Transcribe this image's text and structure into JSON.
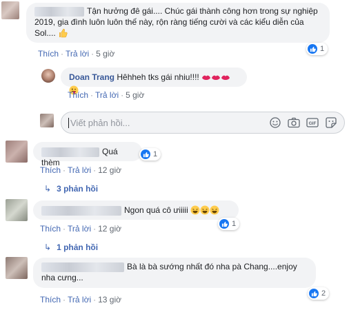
{
  "comments": [
    {
      "text": "Tận hưởng đê gái.... Chúc gái thành công hơn trong sự nghiệp 2019, gia đình luôn luôn thế này, rộn ràng tiếng cười và các kiểu diễn của Sol.... ",
      "like_label": "Thích",
      "reply_label": "Trả lời",
      "time": "5 giờ",
      "reaction_count": "1"
    },
    {
      "author": "Doan Trang",
      "text": "Hêhheh tks gái nhiu!!!! ",
      "like_label": "Thích",
      "reply_label": "Trả lời",
      "time": "5 giờ"
    },
    {
      "text": "Quá thèm",
      "like_label": "Thích",
      "reply_label": "Trả lời",
      "time": "12 giờ",
      "reaction_count": "1",
      "replies_label": "3 phản hồi"
    },
    {
      "text": "Ngon quá cô ưiiiii ",
      "like_label": "Thích",
      "reply_label": "Trả lời",
      "time": "12 giờ",
      "reaction_count": "1",
      "replies_label": "1 phản hồi"
    },
    {
      "text": "Bà là bà sướng nhất đó nha pà Chang....enjoy nha cưng...",
      "like_label": "Thích",
      "reply_label": "Trả lời",
      "time": "13 giờ",
      "reaction_count": "2"
    }
  ],
  "reply_input": {
    "placeholder": "Viết phản hồi..."
  },
  "icons": [
    "like-icon",
    "thumbs-up-emoji",
    "kiss-mark-emoji",
    "tongue-emoji",
    "laughing-emoji",
    "emoji-icon",
    "camera-icon",
    "gif-icon",
    "sticker-icon",
    "reply-arrow-icon"
  ],
  "colors": {
    "link": "#4267b2",
    "author": "#385898",
    "bubble": "#f2f3f5",
    "like_blue": "#1877f2"
  }
}
